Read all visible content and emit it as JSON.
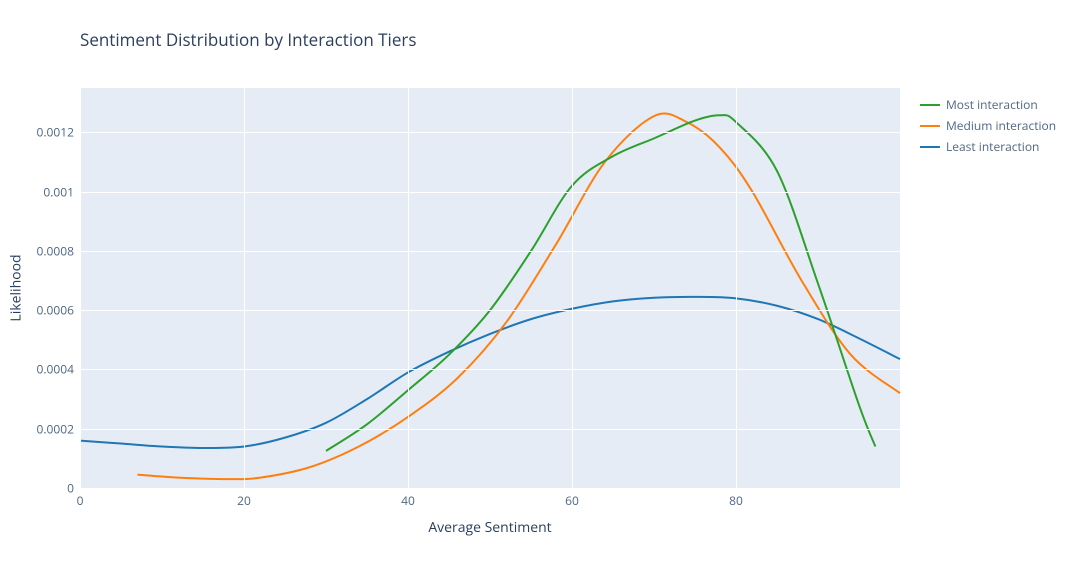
{
  "title": "Sentiment Distribution by Interaction Tiers",
  "xlabel": "Average Sentiment",
  "ylabel": "Likelihood",
  "legend": {
    "items": [
      {
        "label": "Most interaction",
        "color": "#2ca02c"
      },
      {
        "label": "Medium interaction",
        "color": "#ff7f0e"
      },
      {
        "label": "Least interaction",
        "color": "#1f77b4"
      }
    ]
  },
  "xticks": [
    0,
    20,
    40,
    60,
    80
  ],
  "yticks": [
    0,
    0.0002,
    0.0004,
    0.0006,
    0.0008,
    0.001,
    0.0012
  ],
  "chart_data": {
    "type": "line",
    "xlabel": "Average Sentiment",
    "ylabel": "Likelihood",
    "xlim": [
      0,
      100
    ],
    "ylim": [
      0,
      0.00135
    ],
    "title": "Sentiment Distribution by Interaction Tiers",
    "series": [
      {
        "name": "Most interaction",
        "color": "#2ca02c",
        "x": [
          30,
          35,
          40,
          45,
          50,
          55,
          60,
          65,
          70,
          75,
          78,
          80,
          85,
          90,
          95,
          97
        ],
        "y": [
          0.000125,
          0.000215,
          0.00033,
          0.00045,
          0.0006,
          0.0008,
          0.00102,
          0.00112,
          0.00118,
          0.00124,
          0.001258,
          0.001235,
          0.00107,
          0.00069,
          0.00028,
          0.00014
        ]
      },
      {
        "name": "Medium interaction",
        "color": "#ff7f0e",
        "x": [
          7,
          12,
          18,
          22,
          28,
          34,
          40,
          46,
          52,
          58,
          64,
          70,
          74,
          78,
          82,
          88,
          94,
          100
        ],
        "y": [
          4.5e-05,
          3.5e-05,
          3e-05,
          3.5e-05,
          7e-05,
          0.00014,
          0.00024,
          0.00037,
          0.00056,
          0.00082,
          0.0011,
          0.001255,
          0.001235,
          0.00115,
          0.001,
          0.0007,
          0.00045,
          0.00032
        ]
      },
      {
        "name": "Least interaction",
        "color": "#1f77b4",
        "x": [
          0,
          5,
          10,
          15,
          20,
          25,
          30,
          35,
          40,
          45,
          50,
          55,
          60,
          65,
          70,
          75,
          80,
          85,
          90,
          95,
          100
        ],
        "y": [
          0.00016,
          0.00015,
          0.00014,
          0.000135,
          0.00014,
          0.00017,
          0.00022,
          0.0003,
          0.00039,
          0.00046,
          0.00052,
          0.00057,
          0.000605,
          0.00063,
          0.000642,
          0.000645,
          0.00064,
          0.000615,
          0.00057,
          0.000505,
          0.000435
        ]
      }
    ]
  }
}
